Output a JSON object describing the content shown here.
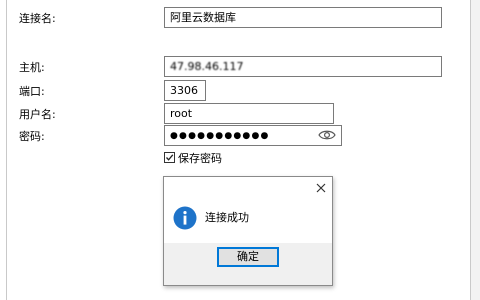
{
  "form": {
    "connection_name_label": "连接名:",
    "connection_name_value": "阿里云数据库",
    "host_label": "主机:",
    "host_value": "47.98.46.117",
    "port_label": "端口:",
    "port_value": "3306",
    "username_label": "用户名:",
    "username_value": "root",
    "password_label": "密码:",
    "password_value": "●●●●●●●●●●●",
    "save_password_label": "保存密码",
    "save_password_checked": true
  },
  "dialog": {
    "message": "连接成功",
    "ok_label": "确定",
    "icon": "info-icon",
    "close_icon": "close-icon"
  },
  "colors": {
    "accent": "#0078d7",
    "info_icon": "#1e73c9"
  }
}
